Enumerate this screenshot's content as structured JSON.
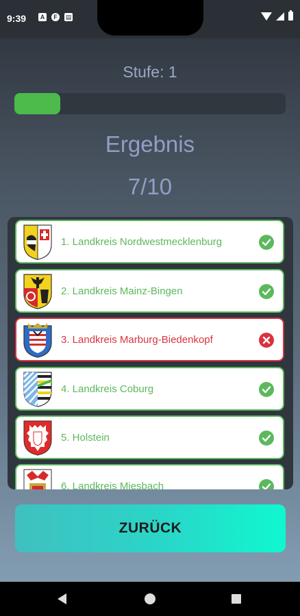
{
  "status_bar": {
    "time": "9:39",
    "notif_icons": [
      "A",
      "F",
      "▤"
    ]
  },
  "stage": {
    "label": "Stufe: 1"
  },
  "progress": {
    "fraction": 0.17,
    "color": "#4cbb4c"
  },
  "result": {
    "title": "Ergebnis",
    "score": "7/10"
  },
  "items": [
    {
      "label": "1. Landkreis Nordwestmecklenburg",
      "status": "correct",
      "crest_icon": "nordwestmecklenburg-crest-icon"
    },
    {
      "label": "2. Landkreis Mainz-Bingen",
      "status": "correct",
      "crest_icon": "mainz-bingen-crest-icon"
    },
    {
      "label": "3. Landkreis Marburg-Biedenkopf",
      "status": "wrong",
      "crest_icon": "marburg-biedenkopf-crest-icon"
    },
    {
      "label": "4. Landkreis Coburg",
      "status": "correct",
      "crest_icon": "coburg-crest-icon"
    },
    {
      "label": "5. Holstein",
      "status": "correct",
      "crest_icon": "holstein-crest-icon"
    },
    {
      "label": "6. Landkreis Miesbach",
      "status": "correct",
      "crest_icon": "miesbach-crest-icon"
    }
  ],
  "colors": {
    "correct": "#5cb85c",
    "wrong": "#d9333f",
    "accent_text": "#929ec5"
  },
  "back_button": {
    "label": "ZURÜCK"
  }
}
